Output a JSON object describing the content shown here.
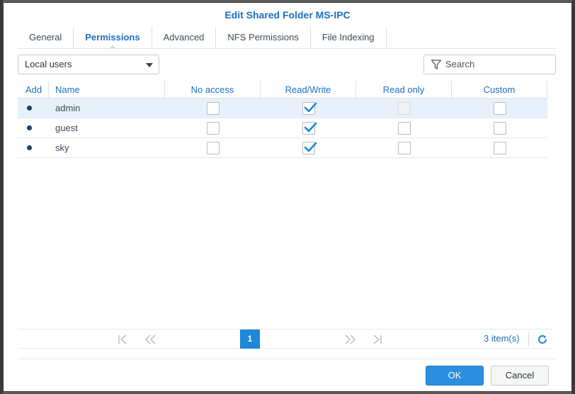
{
  "dialog": {
    "title": "Edit Shared Folder MS-IPC"
  },
  "tabs": [
    {
      "label": "General",
      "active": false
    },
    {
      "label": "Permissions",
      "active": true
    },
    {
      "label": "Advanced",
      "active": false
    },
    {
      "label": "NFS Permissions",
      "active": false
    },
    {
      "label": "File Indexing",
      "active": false
    }
  ],
  "toolbar": {
    "user_type_selected": "Local users",
    "search_placeholder": "Search"
  },
  "grid": {
    "columns": [
      "Add",
      "Name",
      "No access",
      "Read/Write",
      "Read only",
      "Custom"
    ],
    "rows": [
      {
        "name": "admin",
        "no_access": false,
        "read_write": true,
        "read_only": "disabled",
        "custom": false,
        "selected": true
      },
      {
        "name": "guest",
        "no_access": false,
        "read_write": true,
        "read_only": false,
        "custom": false,
        "selected": false
      },
      {
        "name": "sky",
        "no_access": false,
        "read_write": true,
        "read_only": false,
        "custom": false,
        "selected": false
      }
    ]
  },
  "pager": {
    "current_page": "1",
    "items_count": "3 item(s)"
  },
  "footer": {
    "ok_label": "OK",
    "cancel_label": "Cancel"
  },
  "colors": {
    "accent": "#1d6fbf",
    "primary_button": "#2c8fe0",
    "selected_row": "#e8f1fb"
  }
}
